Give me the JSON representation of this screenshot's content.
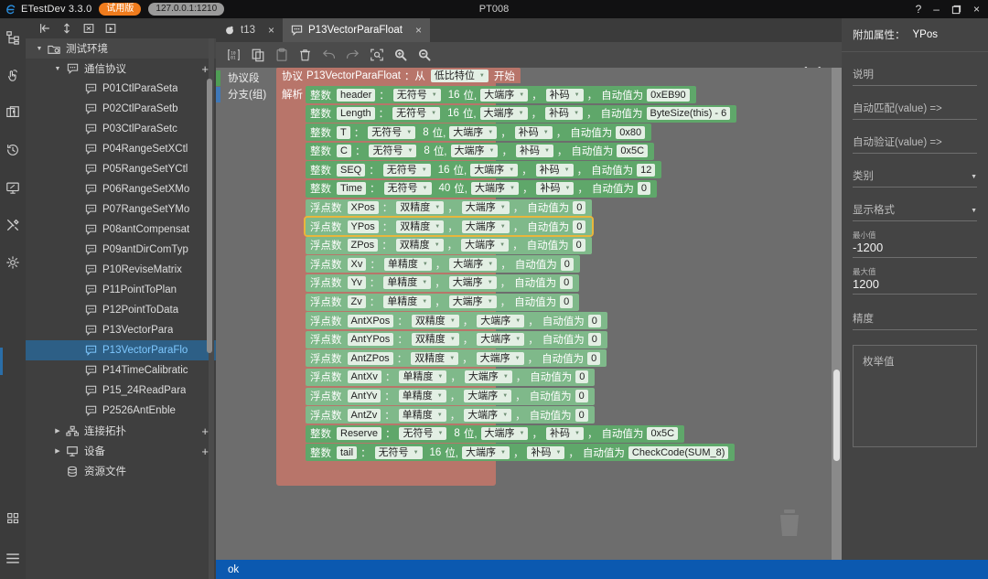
{
  "titlebar": {
    "app_name": "ETestDev 3.3.0",
    "badge_trial": "试用版",
    "badge_address": "127.0.0.1:1210",
    "center_title": "PT008",
    "help": "?",
    "minimize": "–",
    "restore": "restore-icon",
    "close": "×"
  },
  "rail": {
    "items": [
      {
        "name": "project-tree-icon"
      },
      {
        "name": "hand-pointer-icon"
      },
      {
        "name": "layers-icon"
      },
      {
        "name": "history-icon"
      },
      {
        "name": "monitor-icon"
      },
      {
        "name": "tools-icon"
      },
      {
        "name": "gear-icon"
      }
    ],
    "bottom": [
      {
        "name": "grid-icon"
      },
      {
        "name": "menu-icon"
      }
    ]
  },
  "tree": {
    "toolbar": [
      {
        "name": "collapse-to-left-icon"
      },
      {
        "name": "expand-vertical-icon"
      },
      {
        "name": "new-window-icon"
      },
      {
        "name": "run-icon"
      }
    ],
    "nodes": [
      {
        "label": "测试环境",
        "indent": 0,
        "arrow": "down",
        "icon": "environment-icon",
        "plus": false,
        "selected": false
      },
      {
        "label": "通信协议",
        "indent": 1,
        "arrow": "down",
        "icon": "protocol-icon",
        "plus": true,
        "selected": false
      },
      {
        "label": "P01CtlParaSeta",
        "indent": 2,
        "arrow": "none",
        "icon": "protocol-icon",
        "plus": false,
        "selected": false
      },
      {
        "label": "P02CtlParaSetb",
        "indent": 2,
        "arrow": "none",
        "icon": "protocol-icon",
        "plus": false,
        "selected": false
      },
      {
        "label": "P03CtlParaSetc",
        "indent": 2,
        "arrow": "none",
        "icon": "protocol-icon",
        "plus": false,
        "selected": false
      },
      {
        "label": "P04RangeSetXCtl",
        "indent": 2,
        "arrow": "none",
        "icon": "protocol-icon",
        "plus": false,
        "selected": false
      },
      {
        "label": "P05RangeSetYCtl",
        "indent": 2,
        "arrow": "none",
        "icon": "protocol-icon",
        "plus": false,
        "selected": false
      },
      {
        "label": "P06RangeSetXMo",
        "indent": 2,
        "arrow": "none",
        "icon": "protocol-icon",
        "plus": false,
        "selected": false
      },
      {
        "label": "P07RangeSetYMo",
        "indent": 2,
        "arrow": "none",
        "icon": "protocol-icon",
        "plus": false,
        "selected": false
      },
      {
        "label": "P08antCompensat",
        "indent": 2,
        "arrow": "none",
        "icon": "protocol-icon",
        "plus": false,
        "selected": false
      },
      {
        "label": "P09antDirComTyp",
        "indent": 2,
        "arrow": "none",
        "icon": "protocol-icon",
        "plus": false,
        "selected": false
      },
      {
        "label": "P10ReviseMatrix",
        "indent": 2,
        "arrow": "none",
        "icon": "protocol-icon",
        "plus": false,
        "selected": false
      },
      {
        "label": "P11PointToPlan",
        "indent": 2,
        "arrow": "none",
        "icon": "protocol-icon",
        "plus": false,
        "selected": false
      },
      {
        "label": "P12PointToData",
        "indent": 2,
        "arrow": "none",
        "icon": "protocol-icon",
        "plus": false,
        "selected": false
      },
      {
        "label": "P13VectorPara",
        "indent": 2,
        "arrow": "none",
        "icon": "protocol-icon",
        "plus": false,
        "selected": false
      },
      {
        "label": "P13VectorParaFlo",
        "indent": 2,
        "arrow": "none",
        "icon": "protocol-icon",
        "plus": false,
        "selected": true
      },
      {
        "label": "P14TimeCalibratic",
        "indent": 2,
        "arrow": "none",
        "icon": "protocol-icon",
        "plus": false,
        "selected": false
      },
      {
        "label": "P15_24ReadPara",
        "indent": 2,
        "arrow": "none",
        "icon": "protocol-icon",
        "plus": false,
        "selected": false
      },
      {
        "label": "P2526AntEnble",
        "indent": 2,
        "arrow": "none",
        "icon": "protocol-icon",
        "plus": false,
        "selected": false
      },
      {
        "label": "连接拓扑",
        "indent": 1,
        "arrow": "right",
        "icon": "topology-icon",
        "plus": true,
        "selected": false
      },
      {
        "label": "设备",
        "indent": 1,
        "arrow": "right",
        "icon": "device-icon",
        "plus": true,
        "selected": false
      },
      {
        "label": "资源文件",
        "indent": 1,
        "arrow": "none",
        "icon": "database-icon",
        "plus": false,
        "selected": false
      }
    ]
  },
  "editor": {
    "tabs": [
      {
        "label": "t13",
        "icon": "test-icon",
        "active": false,
        "close": "×"
      },
      {
        "label": "P13VectorParaFloat",
        "icon": "protocol-icon",
        "active": true,
        "close": "×"
      }
    ],
    "toolbar": [
      {
        "name": "binary-icon",
        "dim": false
      },
      {
        "name": "copy-icon",
        "dim": false
      },
      {
        "name": "paste-icon",
        "dim": true
      },
      {
        "name": "delete-icon",
        "dim": false
      },
      {
        "name": "undo-icon",
        "dim": true
      },
      {
        "name": "redo-icon",
        "dim": true
      },
      {
        "name": "fit-view-icon",
        "dim": false
      },
      {
        "name": "zoom-in-icon",
        "dim": false
      },
      {
        "name": "zoom-out-icon",
        "dim": false
      }
    ],
    "code_braces": "{…}",
    "gutter": [
      {
        "label": "协议段",
        "color": "#4f9e55"
      },
      {
        "label": "分支(组)",
        "color": "#3f78b8"
      }
    ],
    "protocol_header": {
      "kw": "协议",
      "name": "P13VectorParaFloat",
      "sep": "：从",
      "bitorder": "低比特位",
      "tail": "开始"
    },
    "parse_label": "解析",
    "literals": {
      "colon": "：",
      "comma": "，",
      "bits_unit": "位,",
      "auto_prefix": "自动值为"
    },
    "fields": [
      {
        "kind": "整数",
        "name": "header",
        "sign": "无符号",
        "bits": "16",
        "endian": "大端序",
        "code": "补码",
        "auto": "0xEB90",
        "type": "int",
        "selected": false
      },
      {
        "kind": "整数",
        "name": "Length",
        "sign": "无符号",
        "bits": "16",
        "endian": "大端序",
        "code": "补码",
        "auto": "ByteSize(this) - 6",
        "type": "int",
        "selected": false
      },
      {
        "kind": "整数",
        "name": "T",
        "sign": "无符号",
        "bits": "8",
        "endian": "大端序",
        "code": "补码",
        "auto": "0x80",
        "type": "int",
        "selected": false
      },
      {
        "kind": "整数",
        "name": "C",
        "sign": "无符号",
        "bits": "8",
        "endian": "大端序",
        "code": "补码",
        "auto": "0x5C",
        "type": "int",
        "selected": false
      },
      {
        "kind": "整数",
        "name": "SEQ",
        "sign": "无符号",
        "bits": "16",
        "endian": "大端序",
        "code": "补码",
        "auto": "12",
        "type": "int",
        "selected": false
      },
      {
        "kind": "整数",
        "name": "Time",
        "sign": "无符号",
        "bits": "40",
        "endian": "大端序",
        "code": "补码",
        "auto": "0",
        "type": "int",
        "selected": false
      },
      {
        "kind": "浮点数",
        "name": "XPos",
        "precision": "双精度",
        "endian": "大端序",
        "auto": "0",
        "type": "float",
        "selected": false
      },
      {
        "kind": "浮点数",
        "name": "YPos",
        "precision": "双精度",
        "endian": "大端序",
        "auto": "0",
        "type": "float",
        "selected": true
      },
      {
        "kind": "浮点数",
        "name": "ZPos",
        "precision": "双精度",
        "endian": "大端序",
        "auto": "0",
        "type": "float",
        "selected": false
      },
      {
        "kind": "浮点数",
        "name": "Xv",
        "precision": "单精度",
        "endian": "大端序",
        "auto": "0",
        "type": "float",
        "selected": false
      },
      {
        "kind": "浮点数",
        "name": "Yv",
        "precision": "单精度",
        "endian": "大端序",
        "auto": "0",
        "type": "float",
        "selected": false
      },
      {
        "kind": "浮点数",
        "name": "Zv",
        "precision": "单精度",
        "endian": "大端序",
        "auto": "0",
        "type": "float",
        "selected": false
      },
      {
        "kind": "浮点数",
        "name": "AntXPos",
        "precision": "双精度",
        "endian": "大端序",
        "auto": "0",
        "type": "float",
        "selected": false
      },
      {
        "kind": "浮点数",
        "name": "AntYPos",
        "precision": "双精度",
        "endian": "大端序",
        "auto": "0",
        "type": "float",
        "selected": false
      },
      {
        "kind": "浮点数",
        "name": "AntZPos",
        "precision": "双精度",
        "endian": "大端序",
        "auto": "0",
        "type": "float",
        "selected": false
      },
      {
        "kind": "浮点数",
        "name": "AntXv",
        "precision": "单精度",
        "endian": "大端序",
        "auto": "0",
        "type": "float",
        "selected": false
      },
      {
        "kind": "浮点数",
        "name": "AntYv",
        "precision": "单精度",
        "endian": "大端序",
        "auto": "0",
        "type": "float",
        "selected": false
      },
      {
        "kind": "浮点数",
        "name": "AntZv",
        "precision": "单精度",
        "endian": "大端序",
        "auto": "0",
        "type": "float",
        "selected": false
      },
      {
        "kind": "整数",
        "name": "Reserve",
        "sign": "无符号",
        "bits": "8",
        "endian": "大端序",
        "code": "补码",
        "auto": "0x5C",
        "type": "int",
        "selected": false
      },
      {
        "kind": "整数",
        "name": "tail",
        "sign": "无符号",
        "bits": "16",
        "endian": "大端序",
        "code": "补码",
        "auto": "CheckCode(SUM_8)",
        "type": "int",
        "selected": false
      }
    ]
  },
  "properties": {
    "title": "附加属性：",
    "target": "YPos",
    "description_label": "说明",
    "auto_match_label": "自动匹配(value) =>",
    "auto_verify_label": "自动验证(value) =>",
    "category_label": "类别",
    "display_format_label": "显示格式",
    "min_label": "最小值",
    "min_value": "-1200",
    "max_label": "最大值",
    "max_value": "1200",
    "precision_label": "精度",
    "enum_label": "枚举值"
  },
  "status": {
    "text": "ok"
  },
  "colors": {
    "accent_blue": "#0b59b0",
    "int_row": "#5fa76a",
    "float_row": "#7fb98a",
    "protocol_block": "#b8756a",
    "selection": "#e8b63c",
    "tree_selected": "#2d5f86"
  }
}
